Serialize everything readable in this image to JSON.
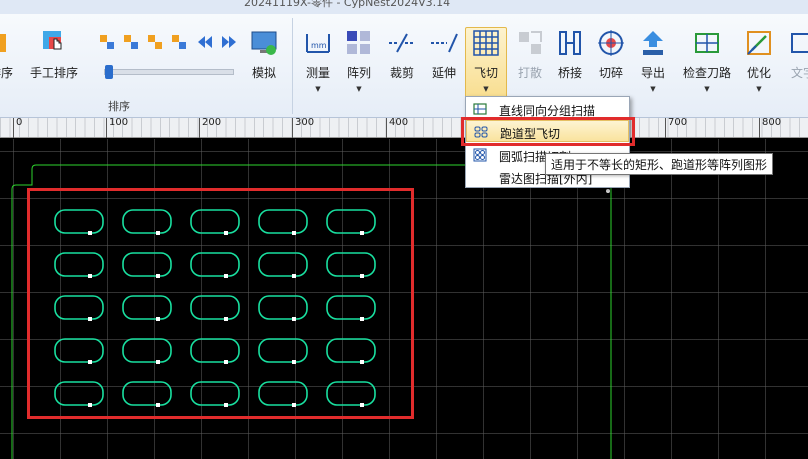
{
  "window": {
    "title": "20241119X-零件 - CypNest2024V3.14"
  },
  "ribbon": {
    "buttons": [
      {
        "key": "sort",
        "label": "排序"
      },
      {
        "key": "manual_sort",
        "label": "手工排序"
      },
      {
        "key": "simulate",
        "label": "模拟"
      },
      {
        "key": "measure",
        "label": "测量"
      },
      {
        "key": "array",
        "label": "阵列"
      },
      {
        "key": "trim",
        "label": "裁剪"
      },
      {
        "key": "extend",
        "label": "延伸"
      },
      {
        "key": "flycut",
        "label": "飞切"
      },
      {
        "key": "break",
        "label": "打散"
      },
      {
        "key": "bridge",
        "label": "桥接"
      },
      {
        "key": "cut_scrap",
        "label": "切碎"
      },
      {
        "key": "export",
        "label": "导出"
      },
      {
        "key": "check_path",
        "label": "检查刀路"
      },
      {
        "key": "optimize",
        "label": "优化"
      },
      {
        "key": "text",
        "label": "文字"
      }
    ],
    "group_sort_label": "排序"
  },
  "ruler": {
    "ticks": [
      "0",
      "100",
      "200",
      "300",
      "400",
      "500",
      "600",
      "700",
      "800"
    ]
  },
  "flycut_menu": {
    "items": [
      {
        "label": "直线同向分组扫描"
      },
      {
        "label": "跑道型飞切"
      },
      {
        "label": "圆弧扫描切割"
      },
      {
        "label": "雷达图扫描[外内]"
      }
    ],
    "highlighted_index": 1
  },
  "tooltip": {
    "text": "适用于不等长的矩形、跑道形等阵列图形"
  },
  "parts": {
    "rows": 5,
    "columns": 5,
    "color": "#19e0a0"
  },
  "colors": {
    "highlight_red": "#e12c2c",
    "sheet_outline": "#2ed42e",
    "canvas_bg": "#000000"
  }
}
